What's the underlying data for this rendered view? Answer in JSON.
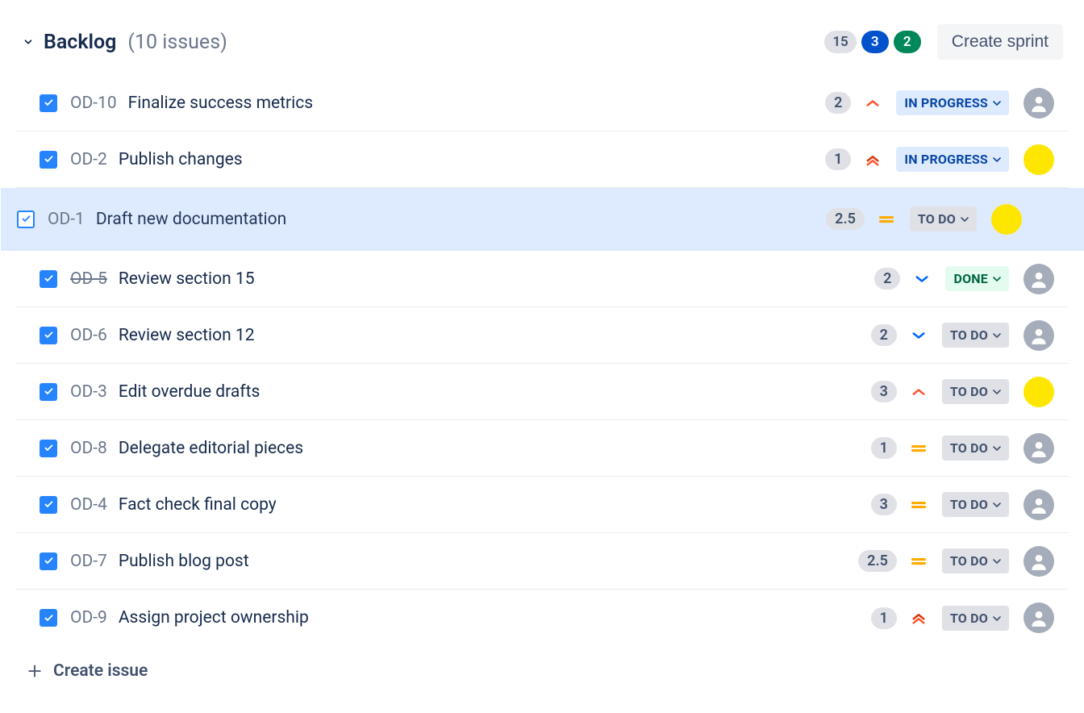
{
  "header": {
    "title": "Backlog",
    "count_label": "(10 issues)",
    "counts": {
      "gray": "15",
      "blue": "3",
      "green": "2"
    },
    "create_sprint_label": "Create sprint"
  },
  "statuses": {
    "in_progress": "IN PROGRESS",
    "to_do": "TO DO",
    "done": "DONE"
  },
  "issues": [
    {
      "key": "OD-10",
      "title": "Finalize success metrics",
      "estimate": "2",
      "priority": "high",
      "status": "in_progress",
      "avatar": "gray",
      "strike": false,
      "selected": false
    },
    {
      "key": "OD-2",
      "title": "Publish changes",
      "estimate": "1",
      "priority": "highest",
      "status": "in_progress",
      "avatar": "yellow",
      "strike": false,
      "selected": false
    },
    {
      "key": "OD-1",
      "title": "Draft new documentation",
      "estimate": "2.5",
      "priority": "medium",
      "status": "to_do",
      "avatar": "yellow",
      "strike": false,
      "selected": true
    },
    {
      "key": "OD-5",
      "title": "Review section 15",
      "estimate": "2",
      "priority": "low",
      "status": "done",
      "avatar": "gray",
      "strike": true,
      "selected": false
    },
    {
      "key": "OD-6",
      "title": "Review section 12",
      "estimate": "2",
      "priority": "low",
      "status": "to_do",
      "avatar": "gray",
      "strike": false,
      "selected": false
    },
    {
      "key": "OD-3",
      "title": "Edit overdue drafts",
      "estimate": "3",
      "priority": "high",
      "status": "to_do",
      "avatar": "yellow",
      "strike": false,
      "selected": false
    },
    {
      "key": "OD-8",
      "title": "Delegate editorial pieces",
      "estimate": "1",
      "priority": "medium",
      "status": "to_do",
      "avatar": "gray",
      "strike": false,
      "selected": false
    },
    {
      "key": "OD-4",
      "title": "Fact check final copy",
      "estimate": "3",
      "priority": "medium",
      "status": "to_do",
      "avatar": "gray",
      "strike": false,
      "selected": false
    },
    {
      "key": "OD-7",
      "title": "Publish blog post",
      "estimate": "2.5",
      "priority": "medium",
      "status": "to_do",
      "avatar": "gray",
      "strike": false,
      "selected": false
    },
    {
      "key": "OD-9",
      "title": "Assign project ownership",
      "estimate": "1",
      "priority": "highest",
      "status": "to_do",
      "avatar": "gray",
      "strike": false,
      "selected": false
    }
  ],
  "create_issue_label": "Create issue"
}
